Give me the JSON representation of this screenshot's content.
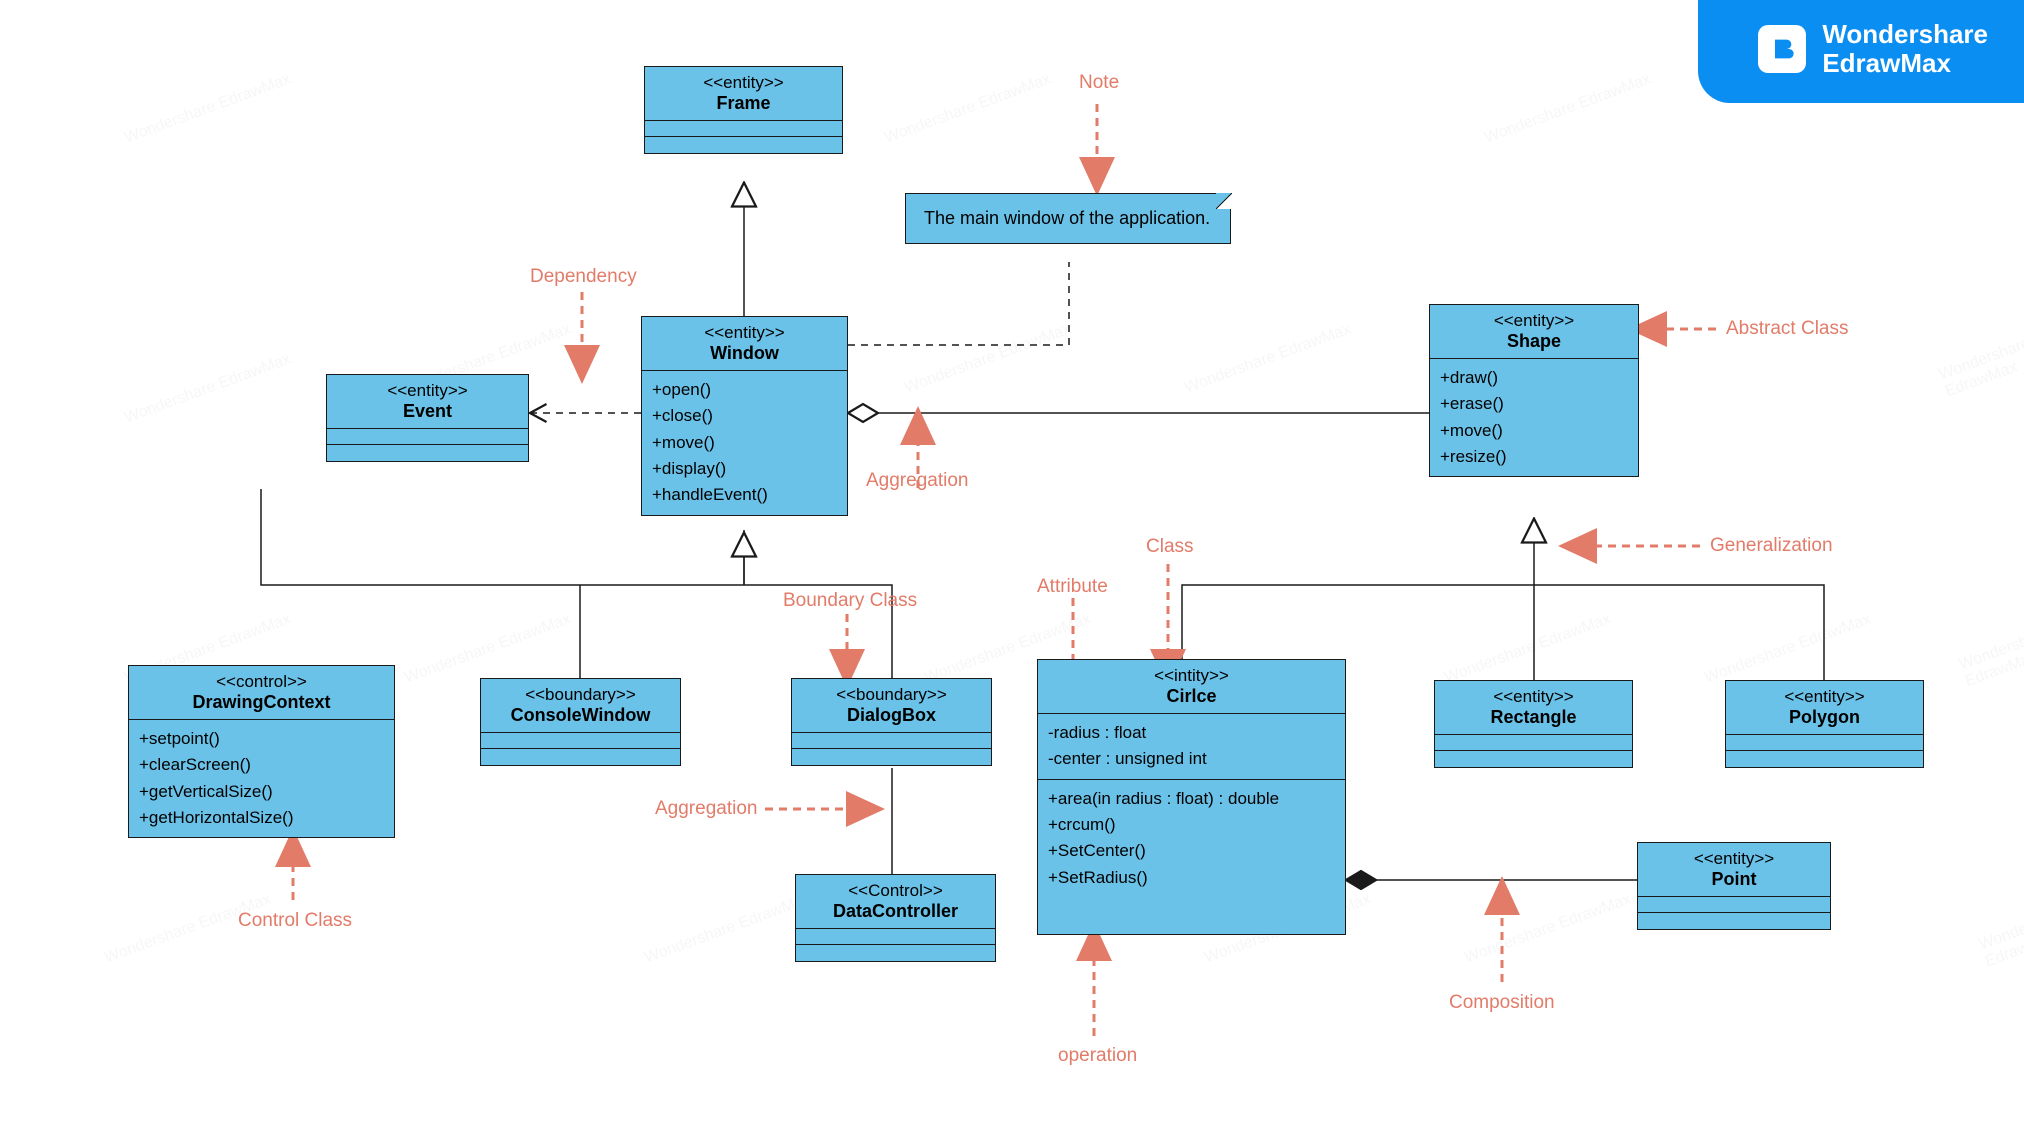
{
  "badge": {
    "line1": "Wondershare",
    "line2": "EdrawMax"
  },
  "watermark": "Wondershare EdrawMax",
  "note": {
    "text": "The main window of the application."
  },
  "classes": {
    "frame": {
      "stereo": "<<entity>>",
      "name": "Frame"
    },
    "window": {
      "stereo": "<<entity>>",
      "name": "Window",
      "ops": [
        "+open()",
        "+close()",
        "+move()",
        "+display()",
        "+handleEvent()"
      ]
    },
    "event": {
      "stereo": "<<entity>>",
      "name": "Event"
    },
    "shape": {
      "stereo": "<<entity>>",
      "name": "Shape",
      "ops": [
        "+draw()",
        "+erase()",
        "+move()",
        "+resize()"
      ]
    },
    "drawing": {
      "stereo": "<<control>>",
      "name": "DrawingContext",
      "ops": [
        "+setpoint()",
        "+clearScreen()",
        "+getVerticalSize()",
        "+getHorizontalSize()"
      ]
    },
    "console": {
      "stereo": "<<boundary>>",
      "name": "ConsoleWindow"
    },
    "dialog": {
      "stereo": "<<boundary>>",
      "name": "DialogBox"
    },
    "circle": {
      "stereo": "<<intity>>",
      "name": "Cirlce",
      "attrs": [
        "-radius : float",
        "-center : unsigned int"
      ],
      "ops": [
        "+area(in radius : float) : double",
        "+crcum()",
        "+SetCenter()",
        "+SetRadius()"
      ]
    },
    "rectangle": {
      "stereo": "<<entity>>",
      "name": "Rectangle"
    },
    "polygon": {
      "stereo": "<<entity>>",
      "name": "Polygon"
    },
    "point": {
      "stereo": "<<entity>>",
      "name": "Point"
    },
    "datacontroller": {
      "stereo": "<<Control>>",
      "name": "DataController"
    }
  },
  "labels": {
    "note": "Note",
    "dependency": "Dependency",
    "aggregation1": "Aggregation",
    "abstract": "Abstract Class",
    "class": "Class",
    "attribute": "Attribute",
    "generalization": "Generalization",
    "boundary": "Boundary Class",
    "aggregation2": "Aggregation",
    "control": "Control Class",
    "operation": "operation",
    "composition": "Composition"
  }
}
